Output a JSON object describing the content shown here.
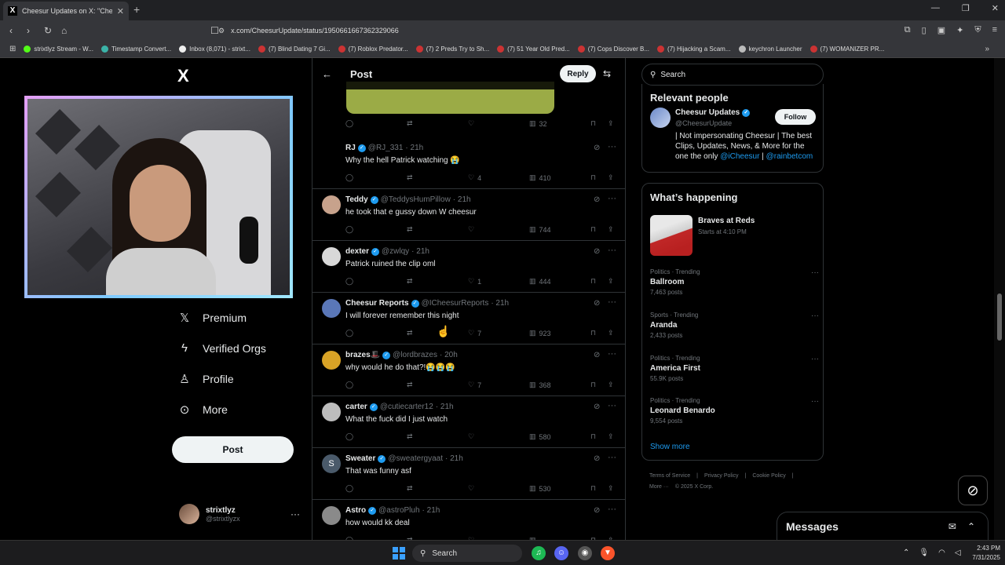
{
  "browser": {
    "tab_title": "Cheesur Updates on X: \"Chees",
    "tab_favicon": "X",
    "url": "x.com/CheesurUpdate/status/1950661667362329066",
    "bookmarks": [
      "strixtlyz Stream - W...",
      "Timestamp Convert...",
      "Inbox (8,071) - strixt...",
      "(7) Blind Dating 7 Gi...",
      "(7) Roblox Predator...",
      "(7) 2 Preds Try to Sh...",
      "(7) 51 Year Old Pred...",
      "(7) Cops Discover B...",
      "(7) Hijacking a Scam...",
      "keychron Launcher",
      "(7) WOMANIZER PR..."
    ]
  },
  "sidebar": {
    "logo": "X",
    "items": [
      {
        "label": "Premium",
        "icon": "x-premium-icon"
      },
      {
        "label": "Verified Orgs",
        "icon": "lightning-icon"
      },
      {
        "label": "Profile",
        "icon": "person-icon"
      },
      {
        "label": "More",
        "icon": "more-circle-icon"
      }
    ],
    "post_label": "Post",
    "account": {
      "name": "strixtlyz",
      "handle": "@strixtlyzx"
    }
  },
  "header": {
    "title": "Post",
    "reply_label": "Reply"
  },
  "top_actions": {
    "views": "32"
  },
  "tweets": [
    {
      "name": "RJ",
      "handle": "@RJ_331",
      "time": "· 21h",
      "text": "Why the hell Patrick watching 😭",
      "replies": "",
      "retweets": "",
      "likes": "4",
      "views": "410",
      "avatar": "#000000"
    },
    {
      "name": "Teddy",
      "handle": "@TeddysHumPillow",
      "time": "· 21h",
      "text": "he took that e gussy down W cheesur",
      "replies": "",
      "retweets": "",
      "likes": "",
      "views": "744",
      "avatar": "#c7a28c"
    },
    {
      "name": "dexter",
      "handle": "@zwlqy",
      "time": "· 21h",
      "text": "Patrick ruined the clip oml",
      "replies": "",
      "retweets": "",
      "likes": "1",
      "views": "444",
      "avatar": "#d8d8d8"
    },
    {
      "name": "Cheesur Reports",
      "handle": "@ICheesurReports",
      "time": "· 21h",
      "text": "I will forever remember this night",
      "replies": "",
      "retweets": "",
      "likes": "7",
      "views": "923",
      "avatar": "#5a77b8"
    },
    {
      "name": "brazes🎩",
      "handle": "@lordbrazes",
      "time": "· 20h",
      "text": "why would he do that?!😭😭😭",
      "replies": "",
      "retweets": "",
      "likes": "7",
      "views": "368",
      "avatar": "#d9a326"
    },
    {
      "name": "carter",
      "handle": "@cutiecarter12",
      "time": "· 21h",
      "text": "What the fuck did I just watch",
      "replies": "",
      "retweets": "",
      "likes": "",
      "views": "580",
      "avatar": "#bdbdbd"
    },
    {
      "name": "Sweater",
      "handle": "@sweatergyaat",
      "time": "· 21h",
      "text": "That was funny asf",
      "replies": "",
      "retweets": "",
      "likes": "",
      "views": "530",
      "avatar": "#4a5a6a",
      "initial": "S"
    },
    {
      "name": "Astro",
      "handle": "@astroPluh",
      "time": "· 21h",
      "text": "how would kk deal",
      "replies": "",
      "retweets": "",
      "likes": "",
      "views": "",
      "avatar": "#8a8a8a"
    }
  ],
  "search": {
    "placeholder": "Search"
  },
  "relevant": {
    "title": "Relevant people",
    "name": "Cheesur Updates",
    "handle": "@CheesurUpdate",
    "follow_label": "Follow",
    "bio_prefix": "| Not impersonating Cheesur | The best Clips, Updates, News, & More for the one the only ",
    "bio_link1": "@iCheesur",
    "bio_mid": " | ",
    "bio_link2": "@rainbetcom"
  },
  "happening": {
    "title": "What’s happening",
    "event_title": "Braves at Reds",
    "event_sub": "Starts at 4:10 PM",
    "trends": [
      {
        "context": "Politics · Trending",
        "title": "Ballroom",
        "posts": "7,463 posts"
      },
      {
        "context": "Sports · Trending",
        "title": "Aranda",
        "posts": "2,433 posts"
      },
      {
        "context": "Politics · Trending",
        "title": "America First",
        "posts": "55.9K posts"
      },
      {
        "context": "Politics · Trending",
        "title": "Leonard Benardo",
        "posts": "9,554 posts"
      }
    ],
    "show_more": "Show more"
  },
  "footer": {
    "links": [
      "Terms of Service",
      "|",
      "Privacy Policy",
      "|",
      "Cookie Policy",
      "|"
    ],
    "more": "More ···",
    "copyright": "© 2025 X Corp."
  },
  "messages": {
    "title": "Messages"
  },
  "taskbar": {
    "search": "Search",
    "time": "2:43 PM",
    "date": "7/31/2025"
  }
}
